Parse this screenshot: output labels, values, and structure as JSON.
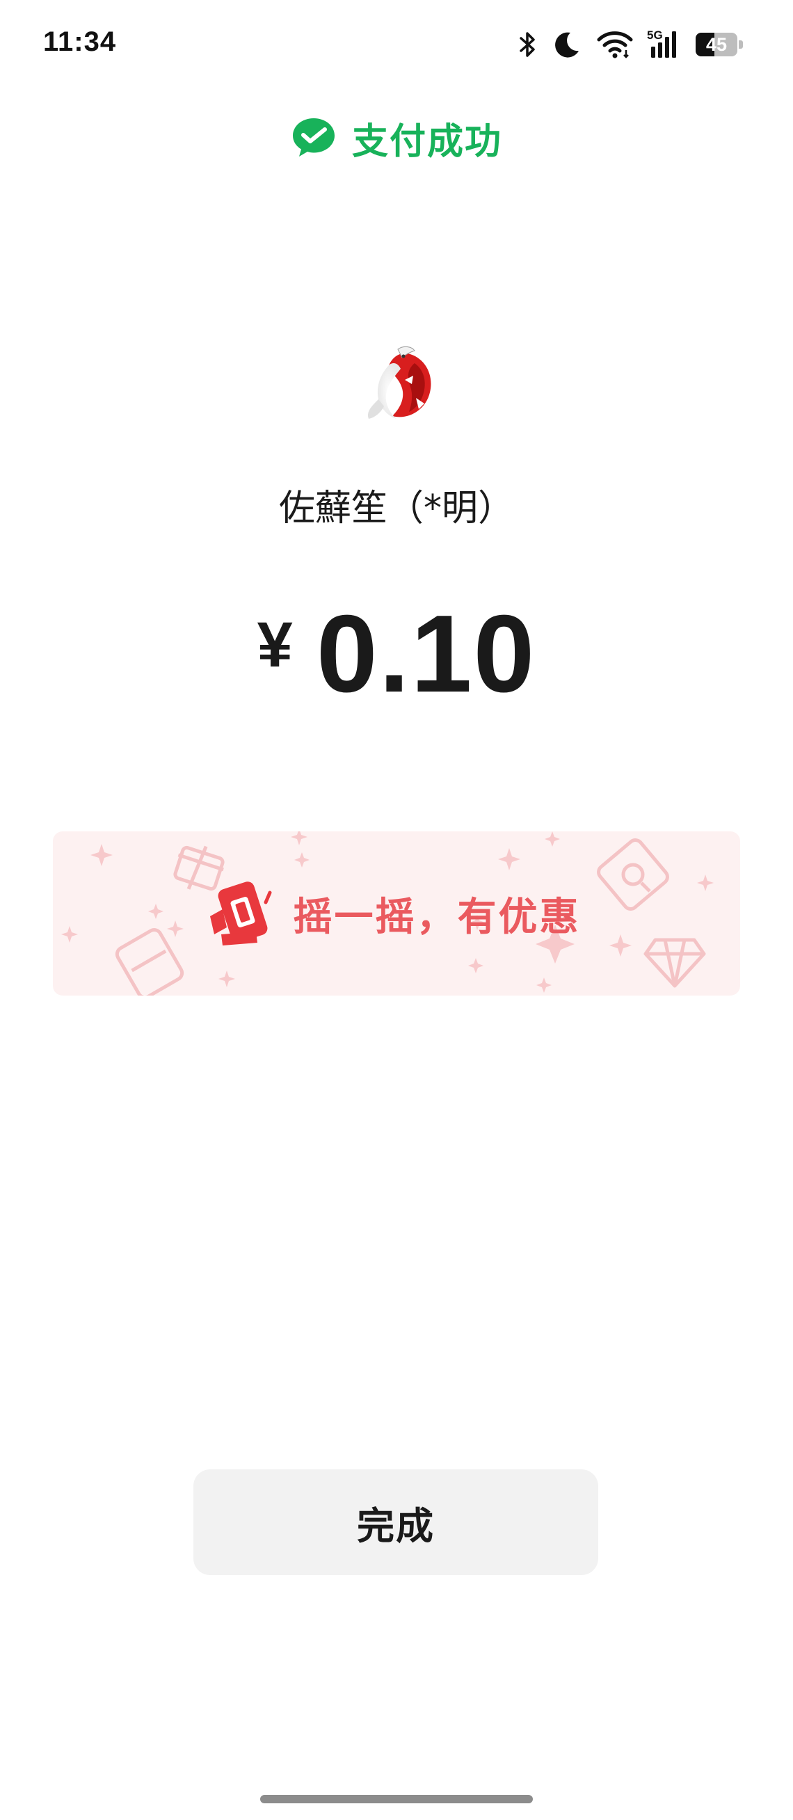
{
  "status_bar": {
    "time": "11:34",
    "network": "5G",
    "battery": "45",
    "battery_level": 0.45,
    "icons": [
      "bluetooth-icon",
      "moon-icon",
      "wifi-icon",
      "signal-icon",
      "battery-icon"
    ]
  },
  "header": {
    "title": "支付成功",
    "icon": "wechat-pay-icon",
    "accent_color": "#18b25a"
  },
  "merchant": {
    "name": "佐蘚笙（*明）",
    "avatar": "koi-fish-avatar"
  },
  "payment": {
    "currency": "¥",
    "amount": "0.10"
  },
  "promo": {
    "text": "摇一摇，有优惠",
    "icon": "shake-phone-icon",
    "text_color": "#ea5a5f",
    "background": "#fdf1f1"
  },
  "actions": {
    "done_label": "完成"
  }
}
